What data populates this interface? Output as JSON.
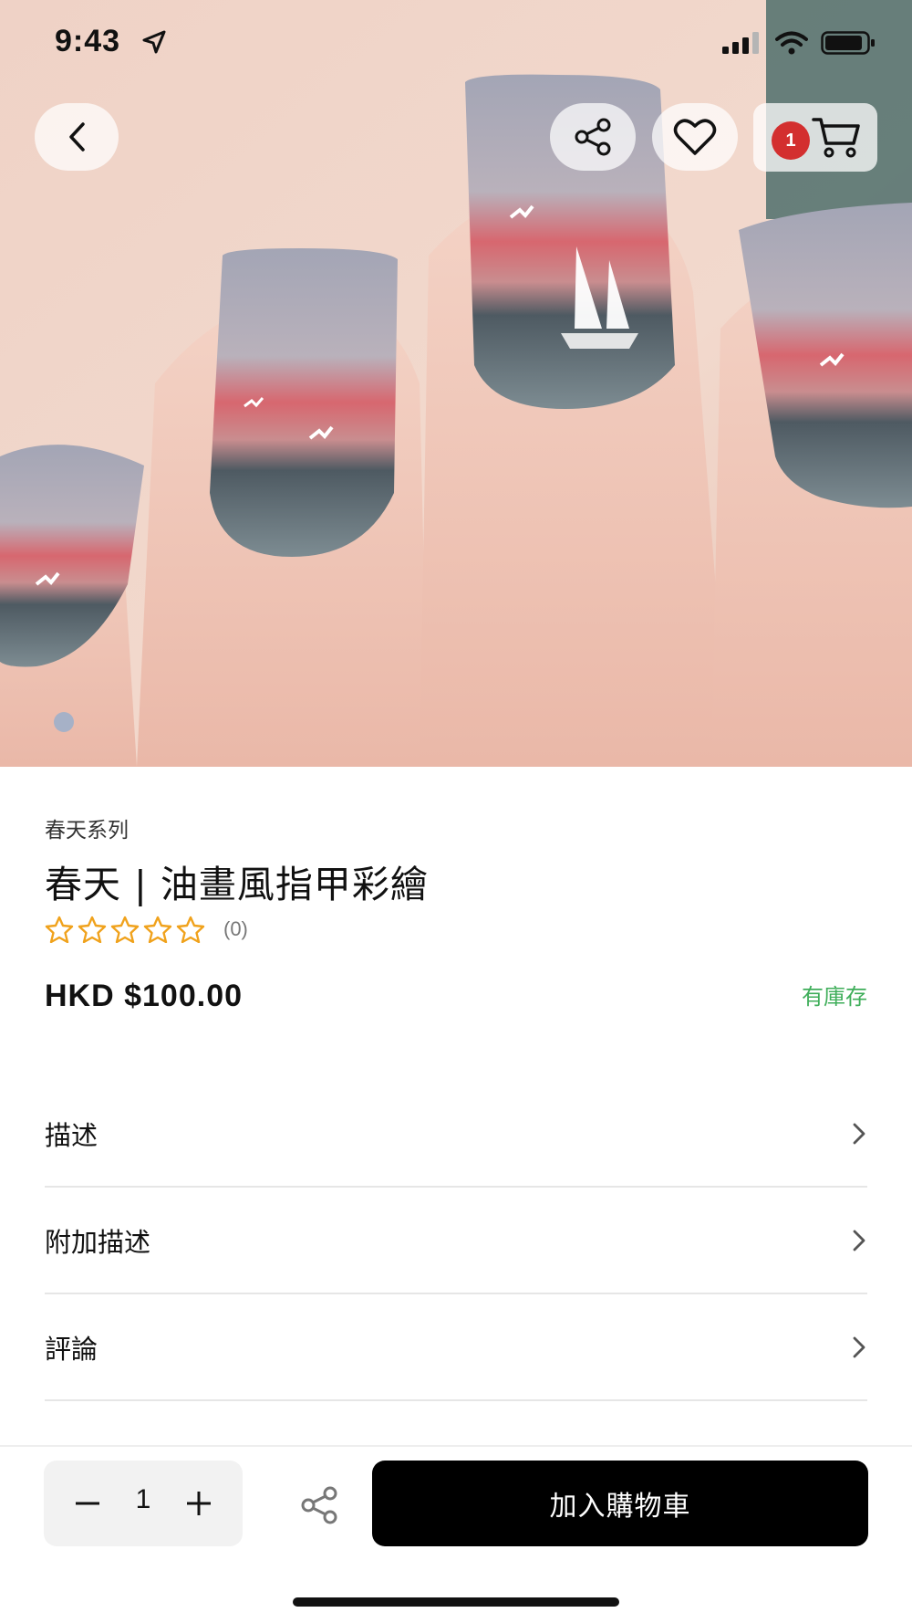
{
  "status_bar": {
    "time": "9:43"
  },
  "header": {
    "cart_count": "1"
  },
  "icons": {
    "back": "chevron-left-icon",
    "share": "share-icon",
    "favorite": "heart-icon",
    "cart": "cart-icon",
    "row_chevron": "chevron-right-icon",
    "minus": "minus-icon",
    "plus": "plus-icon"
  },
  "product": {
    "series": "春天系列",
    "title": "春天 | 油畫風指甲彩繪",
    "rating_stars": 0,
    "rating_count": "(0)",
    "price": "HKD $100.00",
    "stock_status": "有庫存"
  },
  "sections": [
    {
      "label": "描述"
    },
    {
      "label": "附加描述"
    },
    {
      "label": "評論"
    }
  ],
  "purchase": {
    "quantity": "1",
    "add_to_cart_label": "加入購物車"
  },
  "colors": {
    "accent_star": "#f0a21c",
    "stock_green": "#3fae5a",
    "badge_red": "#d32f2f",
    "button_black": "#000000"
  }
}
